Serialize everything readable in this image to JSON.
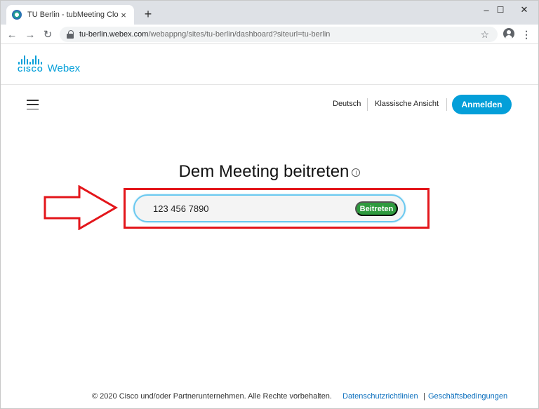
{
  "browser": {
    "tab_title": "TU Berlin - tubMeeting Cloud",
    "tab_close": "×",
    "new_tab": "+",
    "window_controls": {
      "minimize": "–",
      "maximize": "☐",
      "close": "✕"
    },
    "nav": {
      "back": "←",
      "forward": "→",
      "reload": "↻"
    },
    "url_host": "tu-berlin.webex.com",
    "url_path": "/webappng/sites/tu-berlin/dashboard?siteurl=tu-berlin",
    "bookmark_star": "☆",
    "menu": "⋮"
  },
  "brand": {
    "cisco": "CISCO",
    "product": "Webex",
    "color": "#049fd9"
  },
  "header": {
    "language": "Deutsch",
    "classic_view": "Klassische Ansicht",
    "sign_in": "Anmelden"
  },
  "main": {
    "heading": "Dem Meeting beitreten",
    "info_icon": "i",
    "meeting_number": "123 456 7890",
    "join_button": "Beitreten",
    "join_color": "#2e9a3e",
    "highlight_color": "#e3161b"
  },
  "footer": {
    "copyright": "© 2020 Cisco und/oder Partnerunternehmen. Alle Rechte vorbehalten.",
    "privacy": "Datenschutzrichtlinien",
    "separator": "|",
    "terms": "Geschäftsbedingungen"
  }
}
